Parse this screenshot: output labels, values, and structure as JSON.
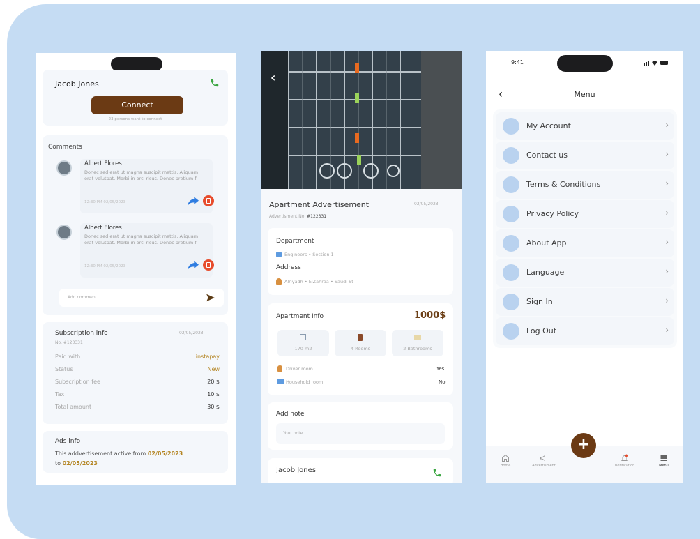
{
  "colors": {
    "background": "#c5dcf3",
    "brand_brown": "#6b3a14",
    "accent_gold": "#b38421",
    "call_green": "#3aa641",
    "share_blue": "#2f7de1",
    "delete_red": "#e74c2c"
  },
  "screen1": {
    "profile": {
      "name": "Jacob Jones",
      "connect_label": "Connect",
      "connect_caption": "23 persons want to connect"
    },
    "comments": {
      "title": "Comments",
      "items": [
        {
          "author": "Albert Flores",
          "body": "Donec sed erat ut magna suscipit mattis. Aliquam erat volutpat. Morbi in orci risus. Donec pretium f",
          "time": "12:30 PM  02/05/2023"
        },
        {
          "author": "Albert Flores",
          "body": "Donec sed erat ut magna suscipit mattis. Aliquam erat volutpat. Morbi in orci risus. Donec pretium f",
          "time": "12:30 PM  02/05/2023"
        }
      ],
      "input_placeholder": "Add comment"
    },
    "subscription": {
      "title": "Subscription info",
      "date": "02/05/2023",
      "number": "No. #123331",
      "rows": [
        {
          "label": "Paid with",
          "value": "instapay"
        },
        {
          "label": "Status",
          "value": "New"
        },
        {
          "label": "Subscription fee",
          "value": "20 $"
        },
        {
          "label": "Tax",
          "value": "10 $"
        },
        {
          "label": "Total amount",
          "value": "30 $"
        }
      ]
    },
    "ads": {
      "title": "Ads info",
      "text": "This addvertisement active from",
      "from": "02/05/2023",
      "to_word": "to",
      "to": "02/05/2023"
    }
  },
  "screen2": {
    "title": "Apartment Advertisement",
    "date": "02/05/2023",
    "ad_number_label": "Advertisment No.",
    "ad_number": "#122331",
    "department_label": "Department",
    "department_value": "Engineers • Section 1",
    "address_label": "Address",
    "address_value": "Alriyadh • ElZahraa • Saudi St",
    "info_title": "Apartment Info",
    "price": "1000$",
    "stats": [
      "170 m2",
      "4 Rooms",
      "2 Bathrooms"
    ],
    "rooms": [
      {
        "label": "Driver room",
        "value": "Yes"
      },
      {
        "label": "Household room",
        "value": "No"
      }
    ],
    "note_title": "Add note",
    "note_placeholder": "Your note",
    "contact_name": "Jacob Jones"
  },
  "screen3": {
    "status_time": "9:41",
    "title": "Menu",
    "items": [
      "My Account",
      "Contact us",
      "Terms & Conditions",
      "Privacy Policy",
      "About App",
      "Language",
      "Sign In",
      "Log Out"
    ],
    "nav": {
      "home": "Home",
      "ads": "Advertisment",
      "notification": "Notification",
      "menu": "Menu"
    }
  }
}
